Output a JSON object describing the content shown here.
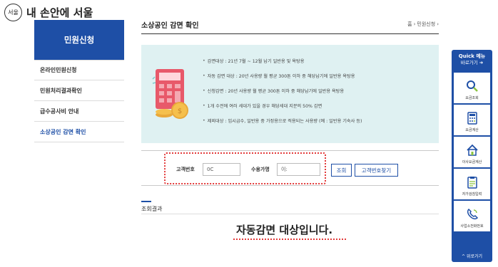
{
  "header": {
    "logo_mark": "서울",
    "logo_text": "내 손안에 서울"
  },
  "sidebar": {
    "title": "민원신청",
    "items": [
      {
        "label": "온라인민원신청"
      },
      {
        "label": "민원처리결과확인"
      },
      {
        "label": "급수공사비 안내"
      },
      {
        "label": "소상공인 감면 확인"
      }
    ]
  },
  "page": {
    "title": "소상공인 감면 확인",
    "breadcrumb": [
      "홈",
      "민원신청"
    ]
  },
  "info": {
    "lines": [
      "감면대상 : 21년 7월 ~ 12월 납기 일반용 및 욕탕용",
      "자동 감면 대상 : 20년 사용량 월 평균 300톤 이하 중 해당납기에 일반용 욕탕용",
      "신청감면 : 20년 사용량 월 평균 300톤 이하 중 해당납기에 일반용 욕탕용",
      "1개 수전에 여러 세대가 있을 경우 해당세대 지분의 50% 감면",
      "제외대상 : 임시급수, 일반용 중 가정용으로 적용되는 사용량 (예 : 일반용 기숙사 등)"
    ]
  },
  "search": {
    "customer_no_label": "고객번호",
    "customer_no_value": "0C",
    "user_name_label": "수용가명",
    "user_name_value": "이:",
    "search_button": "조회",
    "find_button": "고객번호찾기"
  },
  "result": {
    "label": "조회결과",
    "message": "자동감면 대상입니다."
  },
  "quick_menu": {
    "title": "Quick 메뉴",
    "subtitle": "바로가기 ➜",
    "items": [
      {
        "label": "요금조회",
        "icon": "search-icon"
      },
      {
        "label": "요금계산",
        "icon": "calculator-icon"
      },
      {
        "label": "이사요금계산",
        "icon": "home-icon"
      },
      {
        "label": "자가검침입력",
        "icon": "clipboard-icon"
      },
      {
        "label": "사업소전화번호",
        "icon": "phone-icon"
      }
    ],
    "top_label": "위로가기"
  },
  "colors": {
    "primary": "#1e4fa6",
    "info_bg": "#dff1f2",
    "highlight": "#e23b3b"
  }
}
